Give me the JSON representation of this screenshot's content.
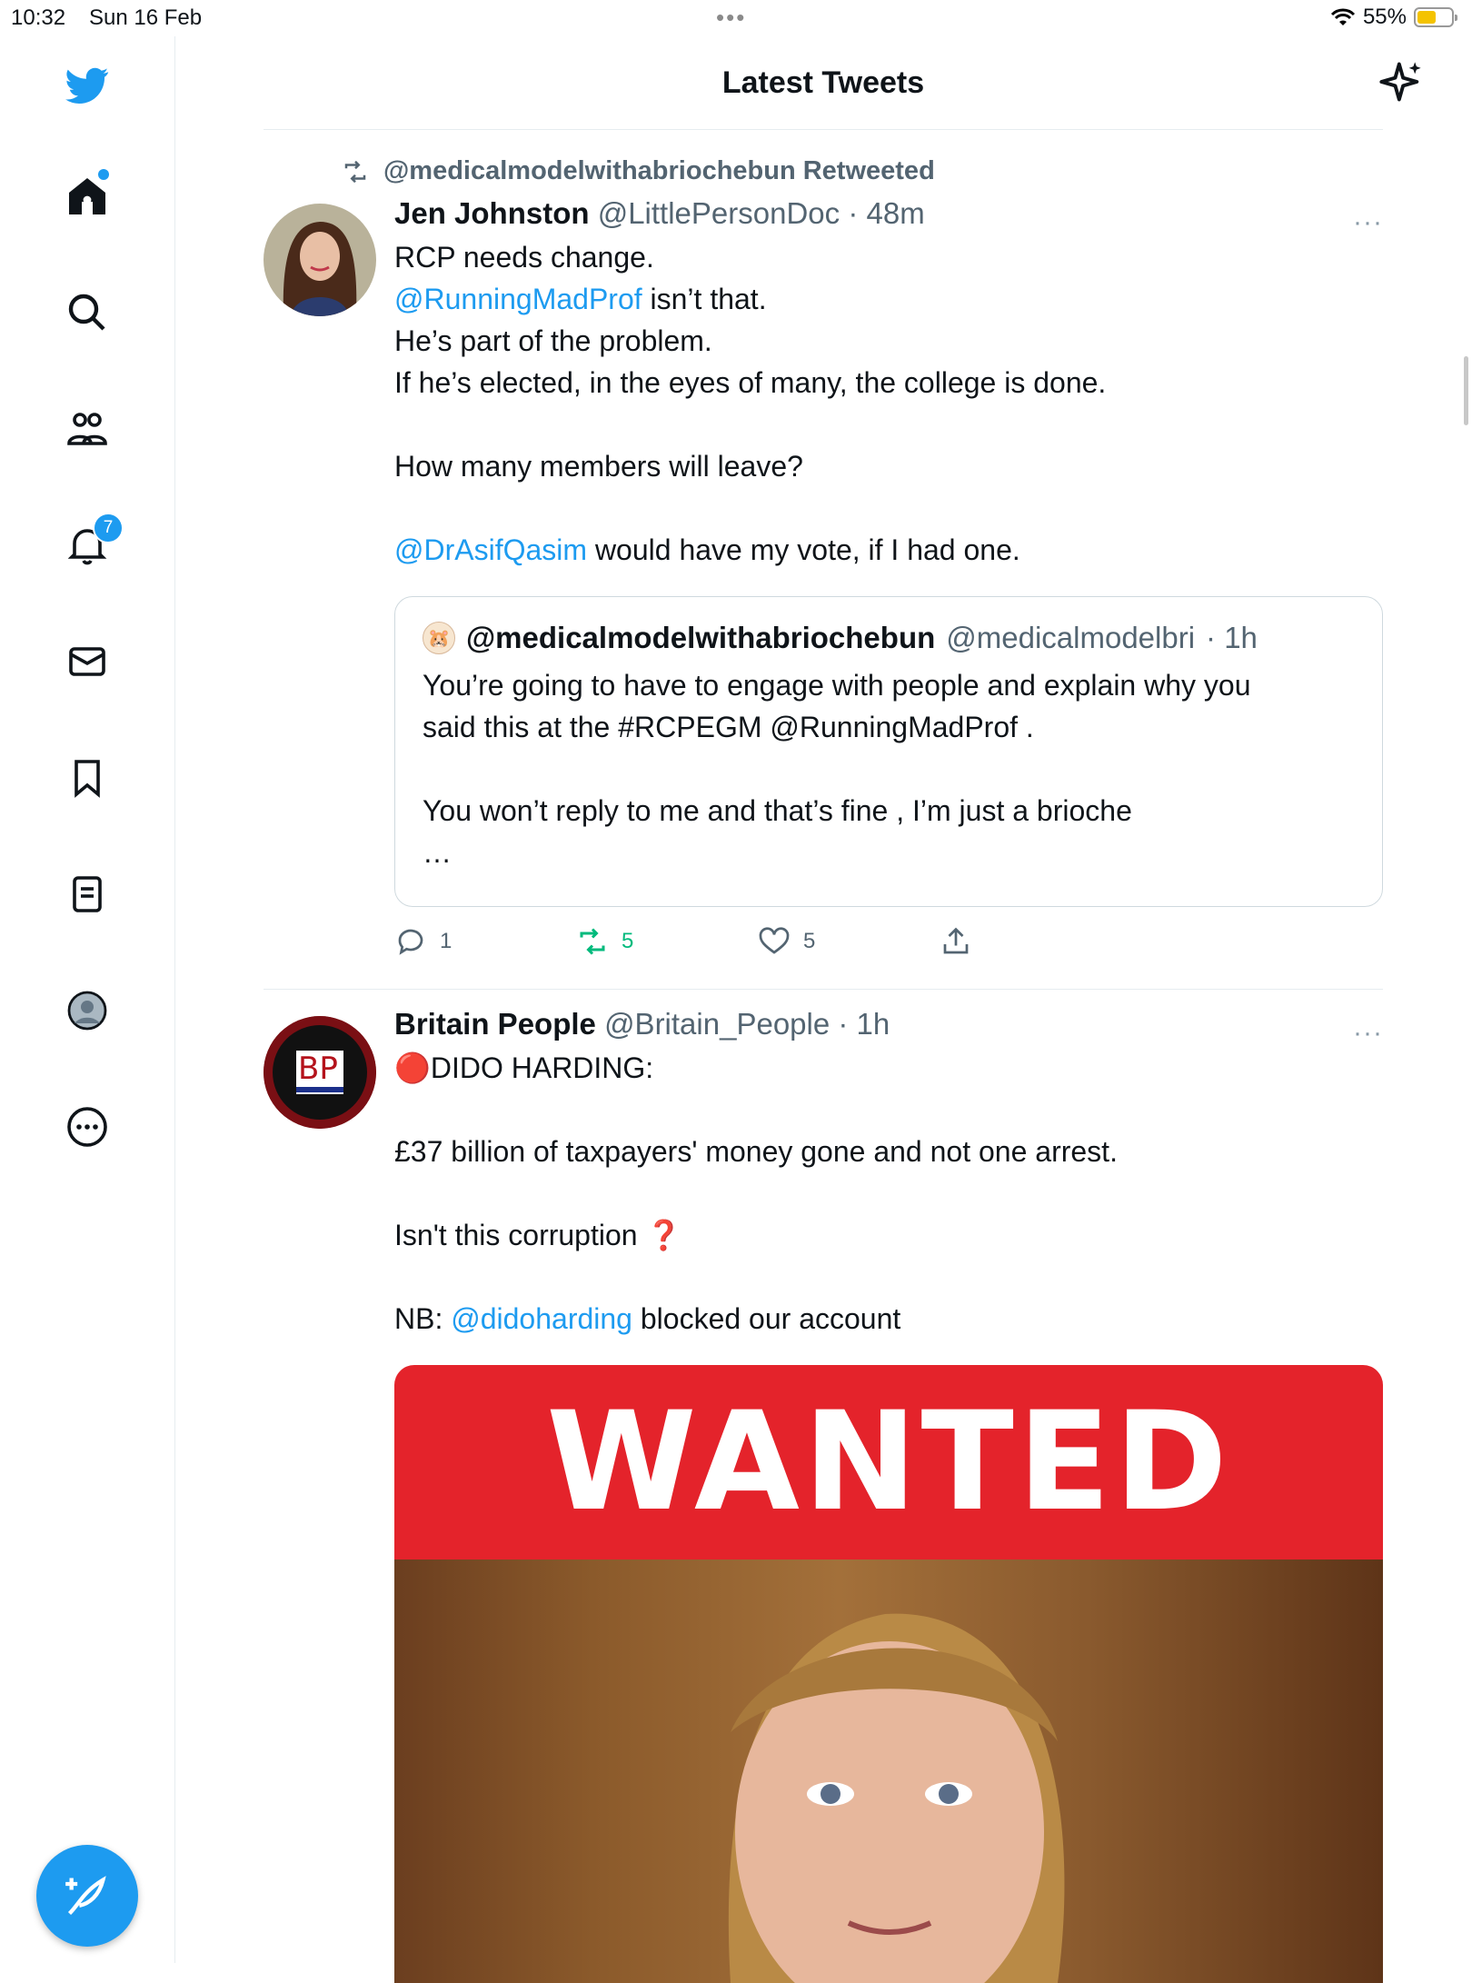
{
  "status_bar": {
    "time": "10:32",
    "date": "Sun 16 Feb",
    "battery": "55%",
    "battery_level": 0.55
  },
  "sidebar": {
    "items": [
      {
        "name": "home-icon"
      },
      {
        "name": "search-icon"
      },
      {
        "name": "communities-icon"
      },
      {
        "name": "notifications-icon",
        "badge": "7"
      },
      {
        "name": "messages-icon"
      },
      {
        "name": "bookmarks-icon"
      },
      {
        "name": "lists-icon"
      },
      {
        "name": "profile-icon"
      },
      {
        "name": "more-icon"
      }
    ],
    "compose": "compose-tweet-button"
  },
  "header": {
    "title": "Latest Tweets"
  },
  "tweets": [
    {
      "retweeted_by": "@medicalmodelwithabriochebun Retweeted",
      "name": "Jen Johnston",
      "handle": "@LittlePersonDoc",
      "time": "· 48m",
      "more": "···",
      "lines": [
        "RCP needs change.",
        "isn’t that.",
        "He’s part of the problem.",
        "If he’s elected, in the eyes of many, the college is done.",
        "How many members will leave?",
        "would have my vote, if I had one."
      ],
      "mentions": [
        "@RunningMadProf",
        "@DrAsifQasim"
      ],
      "quote": {
        "name": "@medicalmodelwithabriochebun",
        "handle": "@medicalmodelbri",
        "time": "· 1h",
        "lines": [
          "You’re going to have to engage with people and explain why you",
          "said this at the #RCPEGM @RunningMadProf .",
          "You won’t reply to me and that’s fine , I’m just a brioche",
          "…"
        ]
      },
      "actions": {
        "replies": "1",
        "retweets": "5",
        "likes": "5"
      }
    },
    {
      "name": "Britain People",
      "handle": "@Britain_People",
      "time": "· 1h",
      "more": "···",
      "avatar_text": "BP",
      "lines": [
        "🔴DIDO HARDING:",
        "£37 billion of taxpayers' money gone and not one arrest.",
        "Isn't this corruption ❓",
        "NB:",
        "blocked our account"
      ],
      "mentions": [
        "@didoharding"
      ],
      "media": {
        "banner": "WANTED"
      }
    }
  ],
  "colors": {
    "accent": "#1d9bf0",
    "retweet": "#00ba7c",
    "banner_red": "#e4232b"
  }
}
